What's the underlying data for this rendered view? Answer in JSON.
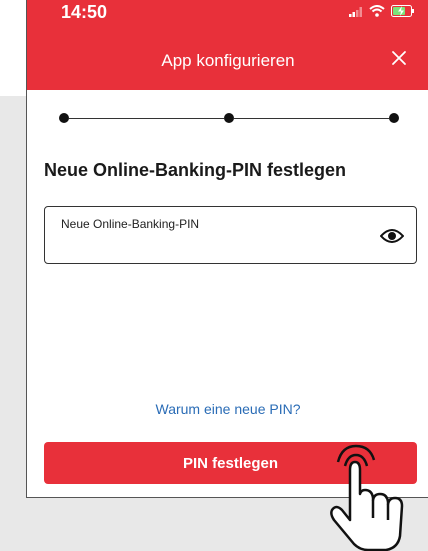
{
  "status_bar": {
    "time": "14:50",
    "icons": [
      "signal-icon",
      "wifi-icon",
      "battery-charging-icon"
    ]
  },
  "header": {
    "title": "App konfigurieren",
    "close_icon": "close-icon"
  },
  "stepper": {
    "steps": 3,
    "current_step": 1
  },
  "main": {
    "heading": "Neue Online-Banking-PIN festlegen",
    "pin_field": {
      "label": "Neue Online-Banking-PIN",
      "value": "",
      "toggle_icon": "eye-icon"
    },
    "help_link": "Warum eine neue PIN?",
    "submit_label": "PIN festlegen"
  },
  "colors": {
    "brand_red": "#e8303a",
    "link_blue": "#2a6cb6",
    "page_gray": "#e8e8e8"
  }
}
